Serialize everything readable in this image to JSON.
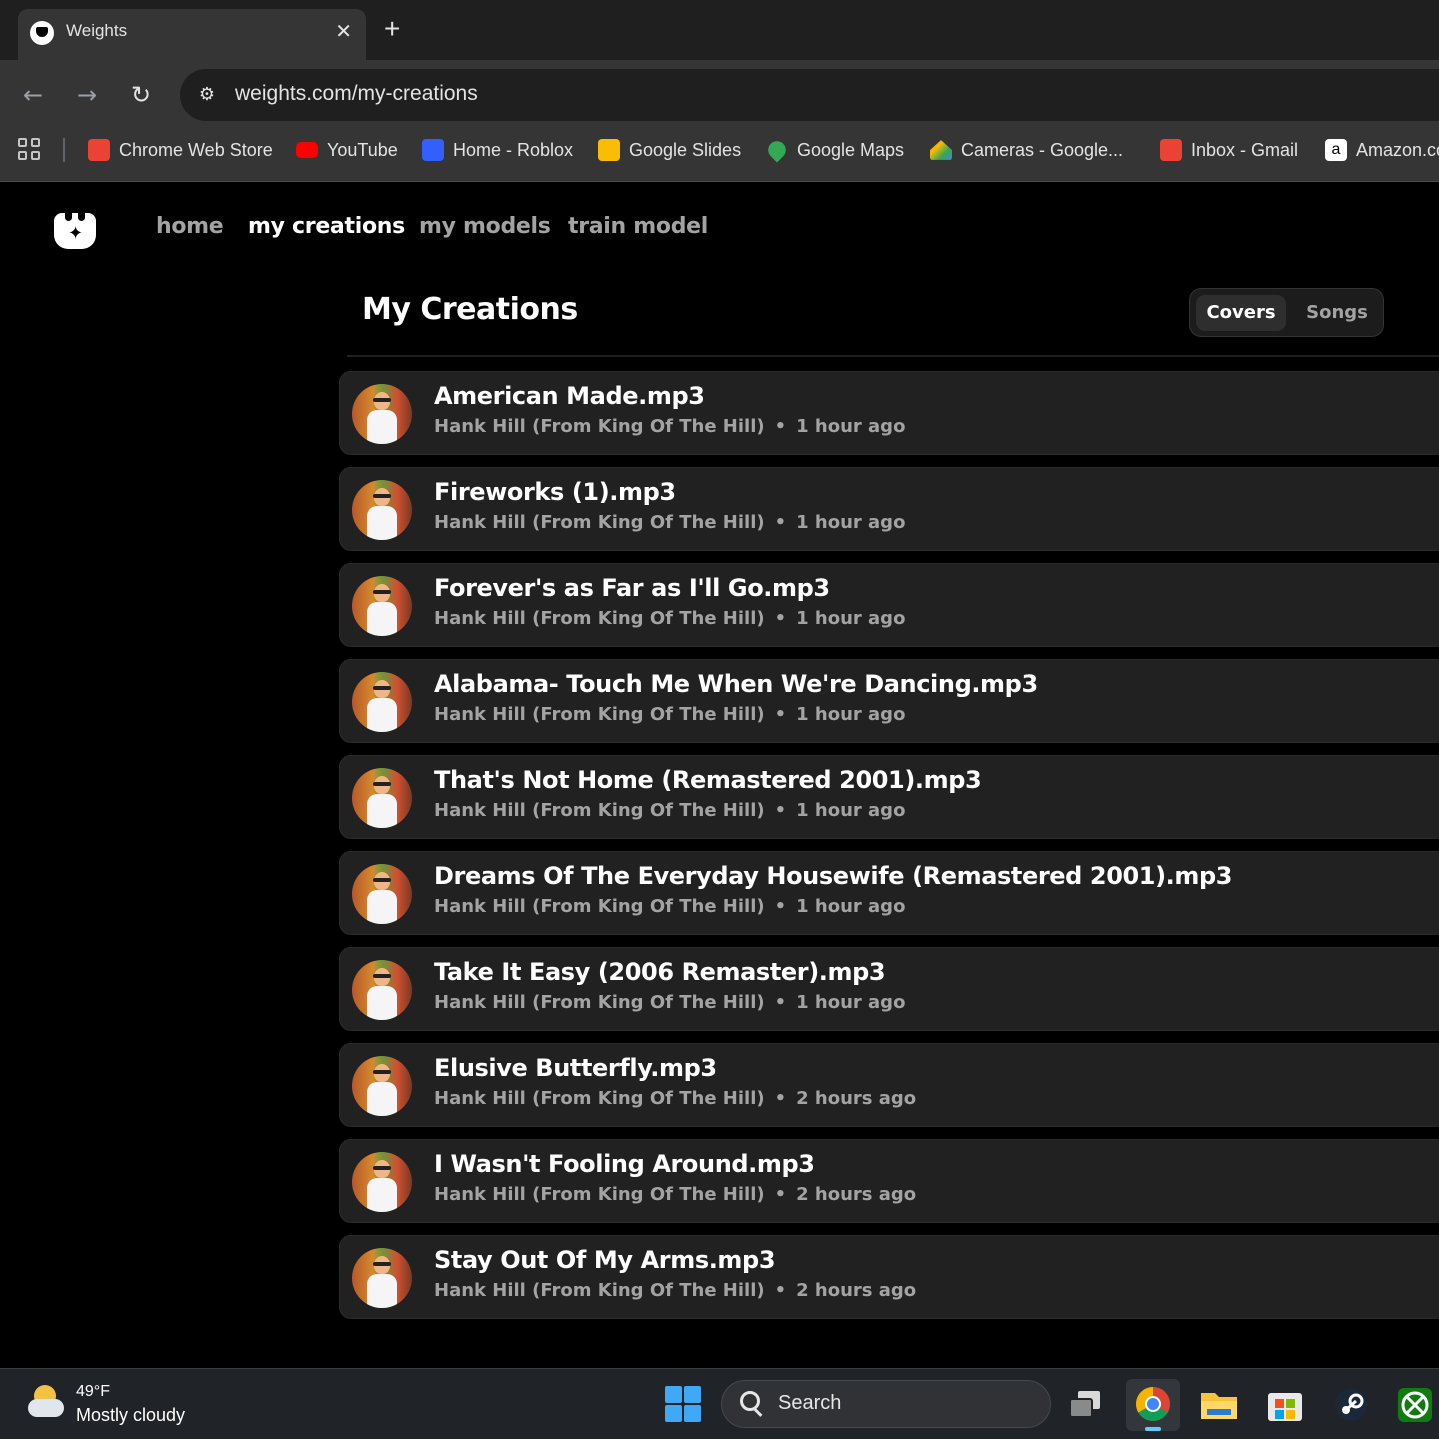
{
  "browser": {
    "tab_title": "Weights",
    "tab_close": "✕",
    "new_tab": "+",
    "url": "weights.com/my-creations",
    "back": "←",
    "forward": "→",
    "reload": "↻",
    "bookmarks": [
      {
        "label": "Chrome Web Store",
        "icon": "chrome-web-store-icon",
        "color": "#ea4335"
      },
      {
        "label": "YouTube",
        "icon": "youtube-icon",
        "color": "#ff0000"
      },
      {
        "label": "Home - Roblox",
        "icon": "roblox-icon",
        "color": "#335fff"
      },
      {
        "label": "Google Slides",
        "icon": "google-slides-icon",
        "color": "#fbbc04"
      },
      {
        "label": "Google Maps",
        "icon": "google-maps-icon",
        "color": "#34a853"
      },
      {
        "label": "Cameras - Google...",
        "icon": "google-home-icon",
        "color": "#4285f4"
      },
      {
        "label": "Inbox - Gmail",
        "icon": "gmail-icon",
        "color": "#ea4335"
      },
      {
        "label": "Amazon.co",
        "icon": "amazon-icon",
        "color": "#ffffff"
      }
    ]
  },
  "site": {
    "nav": [
      {
        "label": "home",
        "active": false
      },
      {
        "label": "my creations",
        "active": true
      },
      {
        "label": "my models",
        "active": false
      },
      {
        "label": "train model",
        "active": false
      }
    ],
    "page_title": "My Creations",
    "toggle": {
      "covers": "Covers",
      "songs": "Songs",
      "selected": "Covers"
    },
    "creations": [
      {
        "title": "American Made.mp3",
        "model": "Hank Hill (From King Of The Hill)",
        "time": "1 hour ago"
      },
      {
        "title": "Fireworks (1).mp3",
        "model": "Hank Hill (From King Of The Hill)",
        "time": "1 hour ago"
      },
      {
        "title": "Forever's as Far as I'll Go.mp3",
        "model": "Hank Hill (From King Of The Hill)",
        "time": "1 hour ago"
      },
      {
        "title": "Alabama- Touch Me When We're Dancing.mp3",
        "model": "Hank Hill (From King Of The Hill)",
        "time": "1 hour ago"
      },
      {
        "title": "That's Not Home (Remastered 2001).mp3",
        "model": "Hank Hill (From King Of The Hill)",
        "time": "1 hour ago"
      },
      {
        "title": "Dreams Of The Everyday Housewife (Remastered 2001).mp3",
        "model": "Hank Hill (From King Of The Hill)",
        "time": "1 hour ago"
      },
      {
        "title": "Take It Easy (2006 Remaster).mp3",
        "model": "Hank Hill (From King Of The Hill)",
        "time": "1 hour ago"
      },
      {
        "title": "Elusive Butterfly.mp3",
        "model": "Hank Hill (From King Of The Hill)",
        "time": "2 hours ago"
      },
      {
        "title": "I Wasn't Fooling Around.mp3",
        "model": "Hank Hill (From King Of The Hill)",
        "time": "2 hours ago"
      },
      {
        "title": "Stay Out Of My Arms.mp3",
        "model": "Hank Hill (From King Of The Hill)",
        "time": "2 hours ago"
      }
    ],
    "separator": "•"
  },
  "taskbar": {
    "weather_temp": "49°F",
    "weather_desc": "Mostly cloudy",
    "search_label": "Search",
    "apps": [
      "task-view-icon",
      "chrome-icon",
      "file-explorer-icon",
      "microsoft-store-icon",
      "steam-icon",
      "xbox-icon"
    ]
  }
}
